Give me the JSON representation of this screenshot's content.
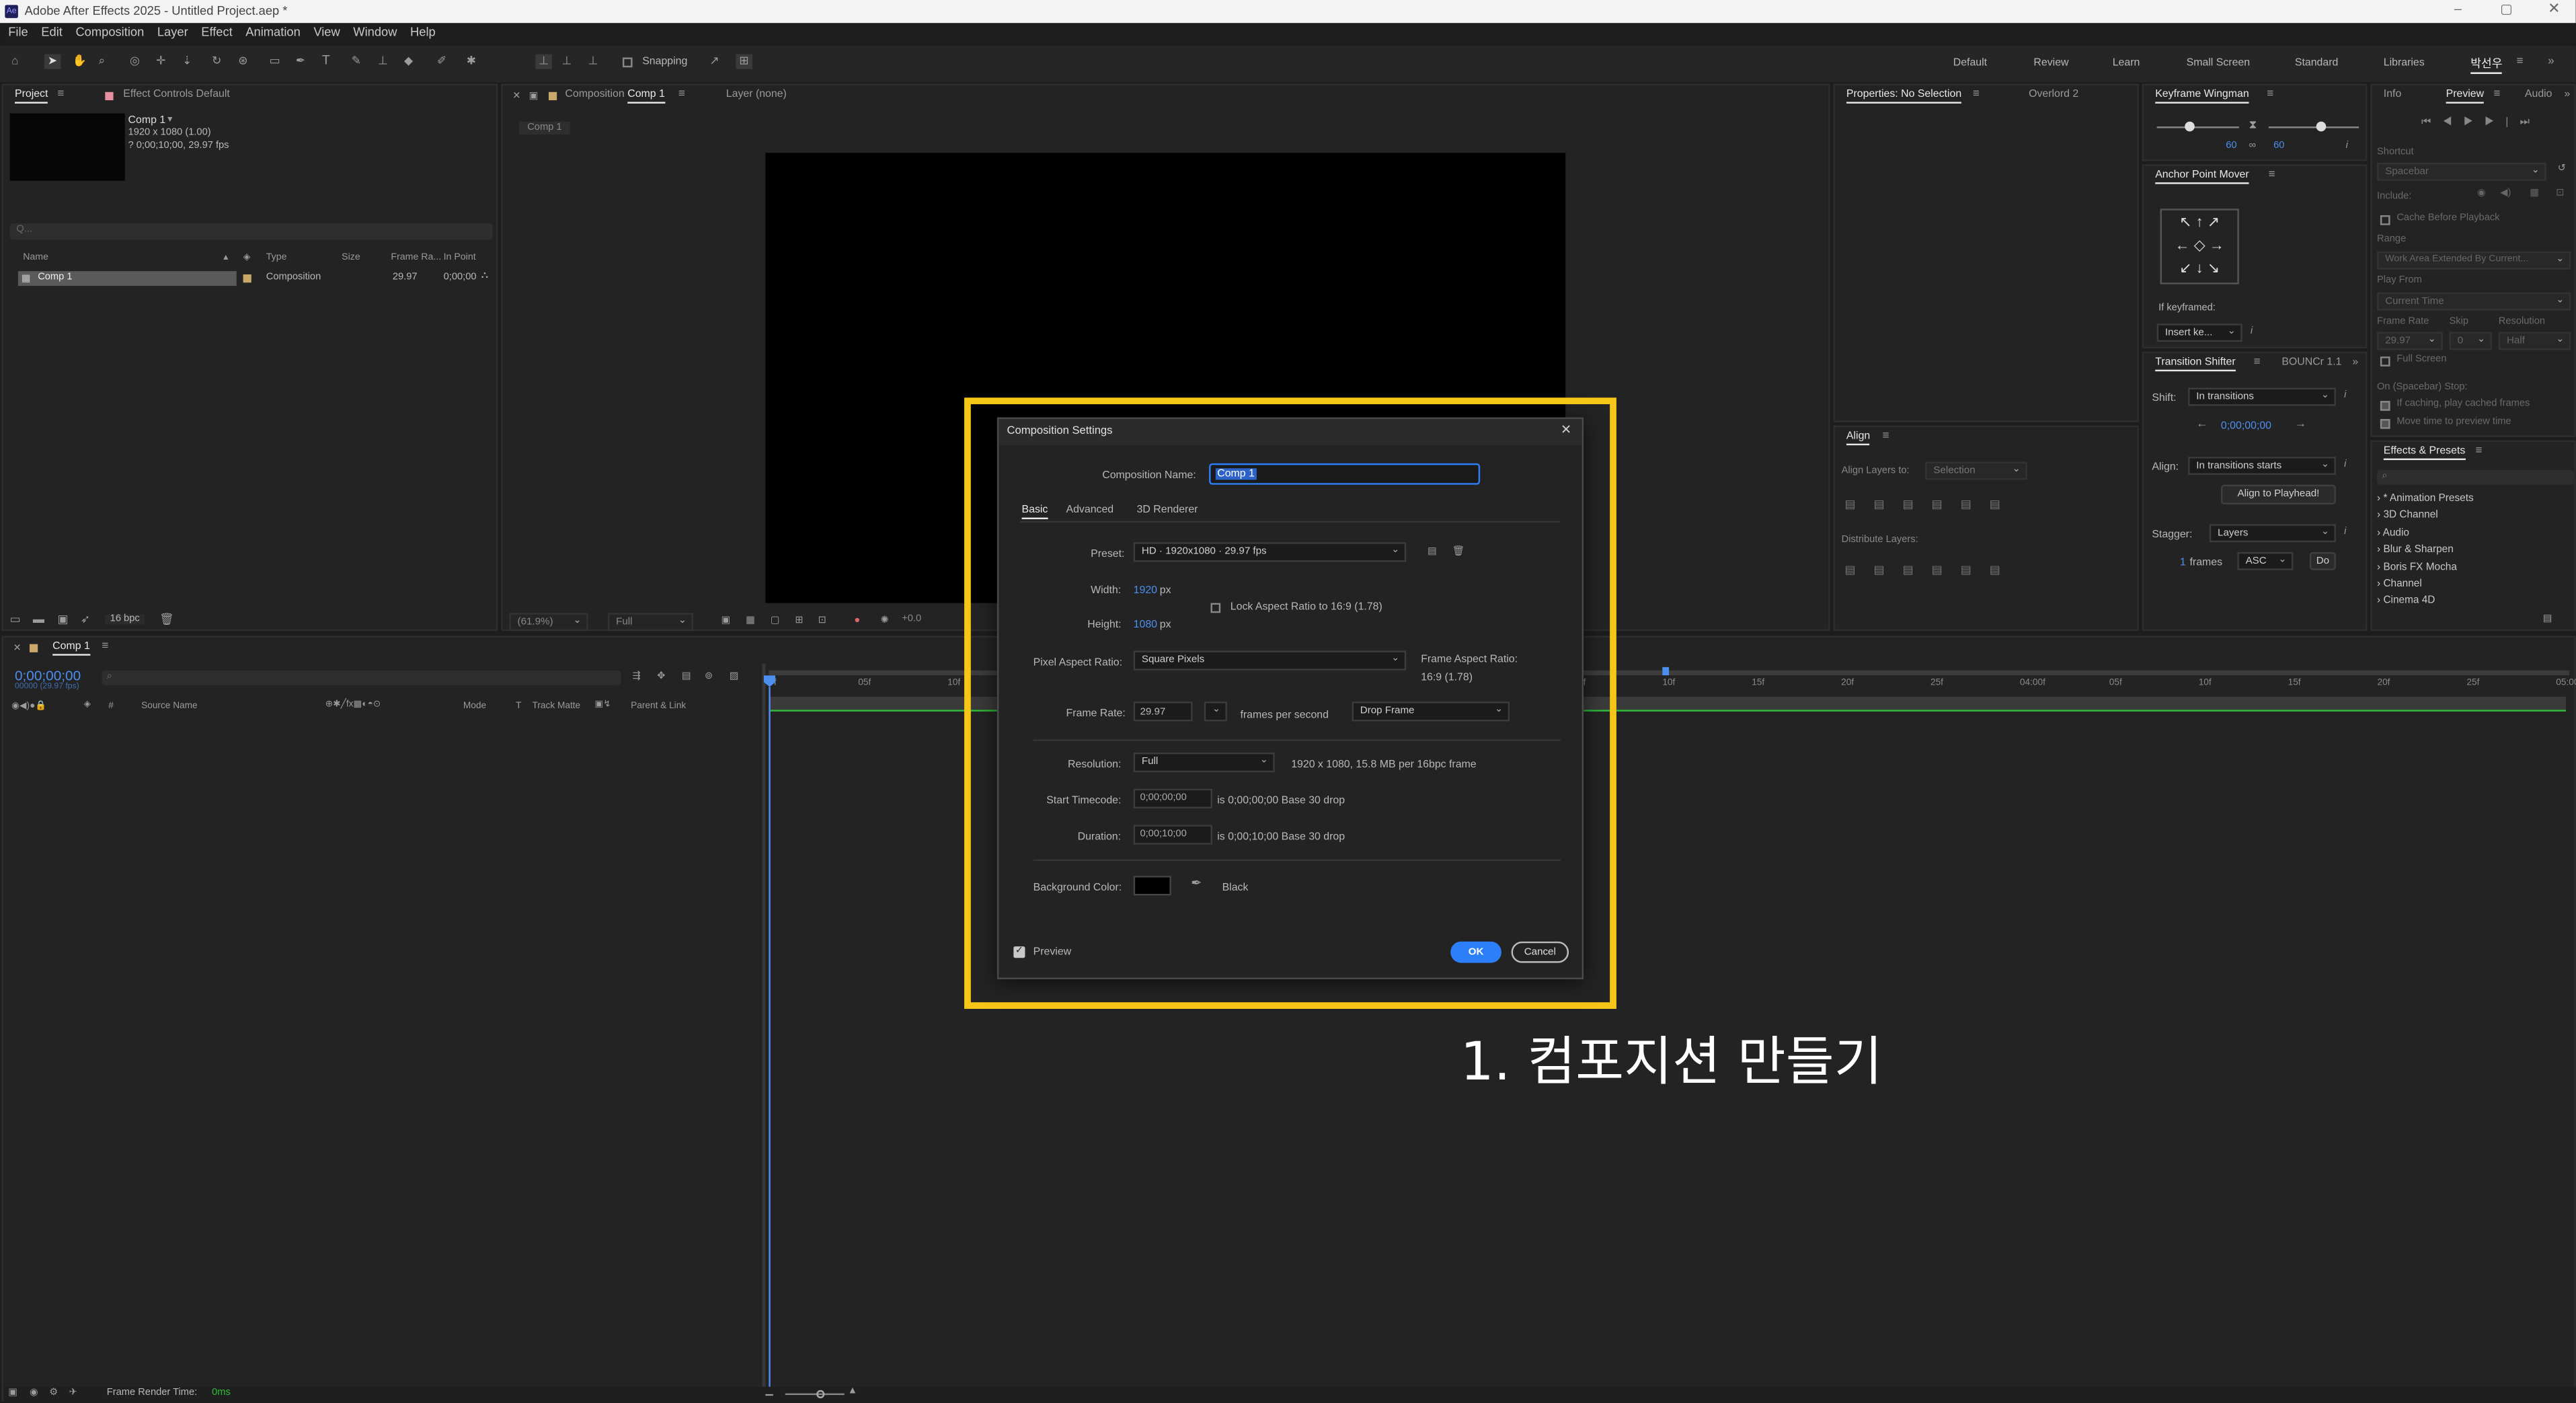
{
  "app": {
    "title": "Adobe After Effects 2025 - Untitled Project.aep *",
    "logo": "Ae"
  },
  "menu": [
    "File",
    "Edit",
    "Composition",
    "Layer",
    "Effect",
    "Animation",
    "View",
    "Window",
    "Help"
  ],
  "toolbar": {
    "snapping_label": "Snapping",
    "workspaces": [
      "Default",
      "Review",
      "Learn",
      "Small Screen",
      "Standard",
      "Libraries"
    ],
    "active_workspace": "박선우"
  },
  "project": {
    "tab": "Project",
    "tab2": "Effect Controls Default",
    "comp_name": "Comp 1",
    "comp_res": "1920 x 1080 (1.00)",
    "comp_dur": "? 0;00;10;00, 29.97 fps",
    "search_placeholder": "Q...",
    "columns": [
      "Name",
      "Type",
      "Size",
      "Frame Ra...",
      "In Point"
    ],
    "rows": [
      {
        "name": "Comp 1",
        "type": "Composition",
        "size": "",
        "fps": "29.97",
        "in": "0;00;00"
      }
    ],
    "bpc": "16 bpc"
  },
  "composition": {
    "tab_prefix": "Composition",
    "tab_name": "Comp 1",
    "layer_tab": "Layer (none)",
    "crumb": "Comp 1",
    "zoom": "(61.9%)",
    "quality": "Full",
    "exposure": "+0.0"
  },
  "properties": {
    "tab": "Properties: No Selection",
    "tab2": "Overlord 2"
  },
  "align": {
    "title": "Align",
    "align_to_label": "Align Layers to:",
    "align_to_value": "Selection",
    "distribute_label": "Distribute Layers:"
  },
  "keyframe_wingman": {
    "title": "Keyframe Wingman",
    "left_value": "60",
    "right_value": "60"
  },
  "anchor_point": {
    "title": "Anchor Point Mover",
    "if_keyframed": "If keyframed:",
    "insert_value": "Insert ke..."
  },
  "transition_shifter": {
    "title": "Transition Shifter",
    "tab2": "BOUNCr 1.1",
    "shift_label": "Shift:",
    "shift_value": "In transitions",
    "time": "0;00;00;00",
    "align_label": "Align:",
    "align_value": "In transitions starts",
    "align_button": "Align to Playhead!",
    "stagger_label": "Stagger:",
    "stagger_value": "Layers",
    "frames_num": "1",
    "frames_label": "frames",
    "order_value": "ASC",
    "do_button": "Do"
  },
  "preview": {
    "tabs": [
      "Info",
      "Preview",
      "Audio"
    ],
    "shortcut_label": "Shortcut",
    "shortcut_value": "Spacebar",
    "include_label": "Include:",
    "cache_label": "Cache Before Playback",
    "range_label": "Range",
    "range_value": "Work Area Extended By Current...",
    "playfrom_label": "Play From",
    "playfrom_value": "Current Time",
    "fr_label": "Frame Rate",
    "skip_label": "Skip",
    "res_label": "Resolution",
    "fr_value": "29.97",
    "skip_value": "0",
    "res_value": "Half",
    "fullscreen_label": "Full Screen",
    "stop_label": "On (Spacebar) Stop:",
    "ifcache_label": "If caching, play cached frames",
    "movetime_label": "Move time to preview time"
  },
  "effects": {
    "title": "Effects & Presets",
    "items": [
      "* Animation Presets",
      "3D Channel",
      "Audio",
      "Blur & Sharpen",
      "Boris FX Mocha",
      "Channel",
      "Cinema 4D"
    ]
  },
  "timeline": {
    "tab": "Comp 1",
    "timecode": "0;00;00;00",
    "timecode_sub": "00000 (29.97 fps)",
    "columns": [
      "Source Name",
      "Mode",
      "T",
      "Track Matte",
      "Parent & Link"
    ],
    "ruler": [
      "0f",
      "05f",
      "10f",
      "15f",
      "10f",
      "15f",
      "20f",
      "25f",
      "03:00f",
      "05f",
      "10f",
      "15f",
      "20f",
      "25f",
      "04:00f",
      "05f",
      "10f",
      "15f",
      "20f",
      "25f",
      "05:00"
    ],
    "render_label": "Frame Render Time:",
    "render_value": "0ms"
  },
  "dialog": {
    "title": "Composition Settings",
    "name_label": "Composition Name:",
    "name_value": "Comp 1",
    "tabs": [
      "Basic",
      "Advanced",
      "3D Renderer"
    ],
    "preset_label": "Preset:",
    "preset_value": "HD · 1920x1080 · 29.97 fps",
    "width_label": "Width:",
    "width_value": "1920",
    "height_label": "Height:",
    "height_value": "1080",
    "px": "px",
    "lock_label": "Lock Aspect Ratio to 16:9 (1.78)",
    "par_label": "Pixel Aspect Ratio:",
    "par_value": "Square Pixels",
    "far_label": "Frame Aspect Ratio:",
    "far_value": "16:9 (1.78)",
    "fr_label": "Frame Rate:",
    "fr_value": "29.97",
    "fps_label": "frames per second",
    "drop_value": "Drop Frame",
    "res_label": "Resolution:",
    "res_value": "Full",
    "res_info": "1920 x 1080, 15.8 MB per 16bpc frame",
    "start_label": "Start Timecode:",
    "start_value": "0;00;00;00",
    "start_info": "is 0;00;00;00  Base 30   drop",
    "dur_label": "Duration:",
    "dur_value": "0;00;10;00",
    "dur_info": "is 0;00;10;00  Base 30   drop",
    "bg_label": "Background Color:",
    "bg_name": "Black",
    "preview_label": "Preview",
    "ok": "OK",
    "cancel": "Cancel"
  },
  "annotation": {
    "caption": "1. 컴포지션 만들기",
    "highlight_color": "#f5c518"
  },
  "colors": {
    "accent": "#2d7ff9",
    "blue_text": "#4c8ff0",
    "green_bar": "#2fbf3a"
  }
}
